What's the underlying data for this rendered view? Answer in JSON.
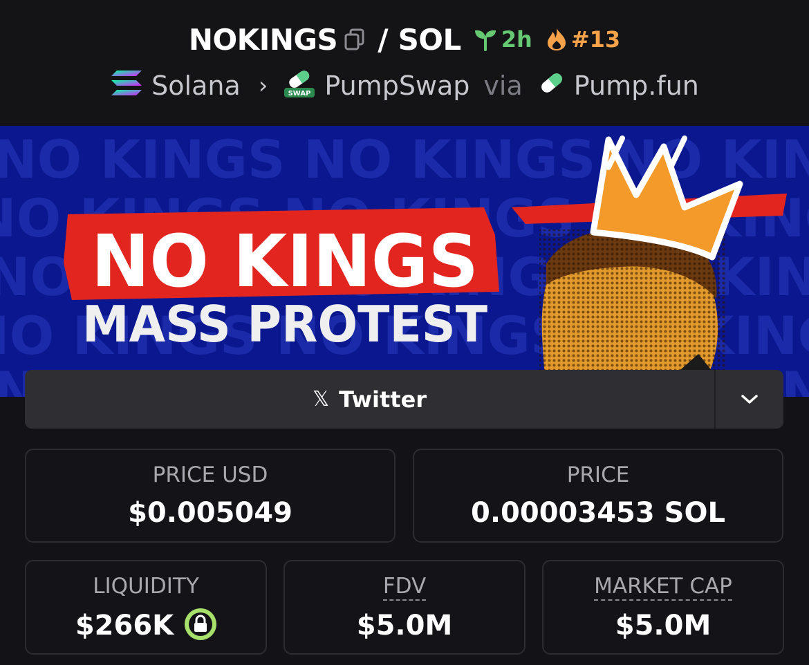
{
  "header": {
    "symbol": "NOKINGS",
    "slash": "/",
    "quote": "SOL",
    "age": "2h",
    "rank": "#13",
    "chain": "Solana",
    "separator": "›",
    "dex": "PumpSwap",
    "dex_badge": "SWAP",
    "via": "via",
    "launchpad": "Pump.fun"
  },
  "banner": {
    "headline": "NO KINGS",
    "subheadline": "MASS PROTEST",
    "background_words": "NO KINGS NO KINGS NO KINGS NO KINGS"
  },
  "social": {
    "icon": "x-logo-icon",
    "label": "Twitter",
    "toggle_icon": "chevron-down-icon"
  },
  "stats": {
    "price_usd_label": "PRICE USD",
    "price_usd_value": "$0.005049",
    "price_label": "PRICE",
    "price_value": "0.00003453 SOL",
    "liquidity_label": "LIQUIDITY",
    "liquidity_value": "$266K",
    "fdv_label": "FDV",
    "fdv_value": "$5.0M",
    "mcap_label": "MARKET CAP",
    "mcap_value": "$5.0M"
  },
  "colors": {
    "age_green": "#67c873",
    "rank_orange": "#f5a24b",
    "lock_green": "#a7e06a",
    "banner_blue": "#0b178f",
    "banner_red": "#e2251f"
  }
}
